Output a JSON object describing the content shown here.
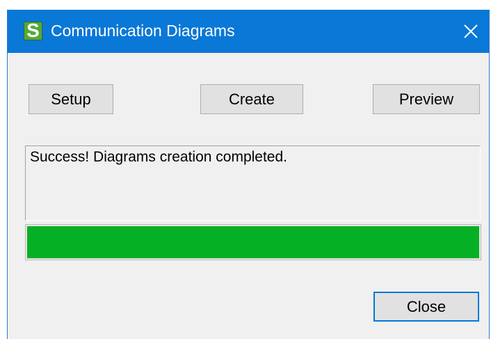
{
  "dialog": {
    "title": "Communication Diagrams",
    "app_icon_letter": "S",
    "accent_color": "#0a78d7"
  },
  "buttons": {
    "setup_label": "Setup",
    "create_label": "Create",
    "preview_label": "Preview",
    "close_label": "Close"
  },
  "status": {
    "message": "Success! Diagrams creation completed."
  },
  "progress": {
    "percent": 100,
    "fill_color": "#06b025"
  },
  "icons": {
    "app": "app-logo-icon",
    "close": "close-icon"
  }
}
